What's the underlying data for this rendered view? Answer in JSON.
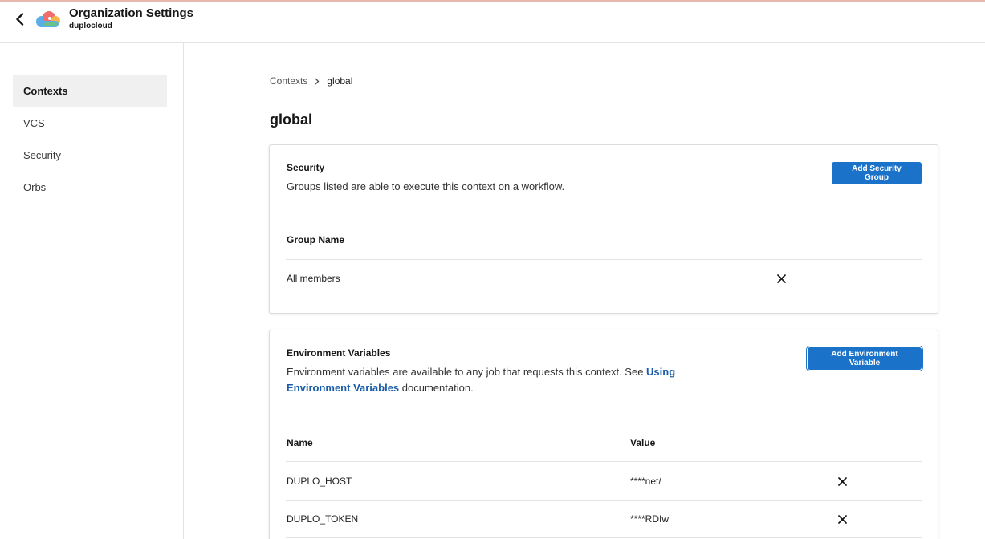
{
  "header": {
    "title": "Organization Settings",
    "org": "duplocloud",
    "back_icon": "chevron-left-icon",
    "logo_icon": "duplocloud-logo"
  },
  "sidebar": {
    "items": [
      {
        "label": "Contexts",
        "active": true
      },
      {
        "label": "VCS",
        "active": false
      },
      {
        "label": "Security",
        "active": false
      },
      {
        "label": "Orbs",
        "active": false
      }
    ]
  },
  "breadcrumb": {
    "parent": "Contexts",
    "current": "global",
    "separator_icon": "chevron-right-icon"
  },
  "page": {
    "title": "global"
  },
  "security": {
    "title": "Security",
    "description": "Groups listed are able to execute this context on a workflow.",
    "add_button": "Add Security Group",
    "column_group_name": "Group Name",
    "rows": [
      {
        "group": "All members"
      }
    ]
  },
  "env": {
    "title": "Environment Variables",
    "desc_before": "Environment variables are available to any job that requests this context. See ",
    "desc_link": "Using Environment Variables",
    "desc_after": " documentation.",
    "add_button": "Add Environment Variable",
    "column_name": "Name",
    "column_value": "Value",
    "rows": [
      {
        "name": "DUPLO_HOST",
        "value": "****net/"
      },
      {
        "name": "DUPLO_TOKEN",
        "value": "****RDIw"
      }
    ]
  },
  "colors": {
    "accent": "#1b73c9",
    "link": "#1a5ca8",
    "active_nav_bg": "#f0f0f0",
    "top_line": "#e8b7ad"
  }
}
